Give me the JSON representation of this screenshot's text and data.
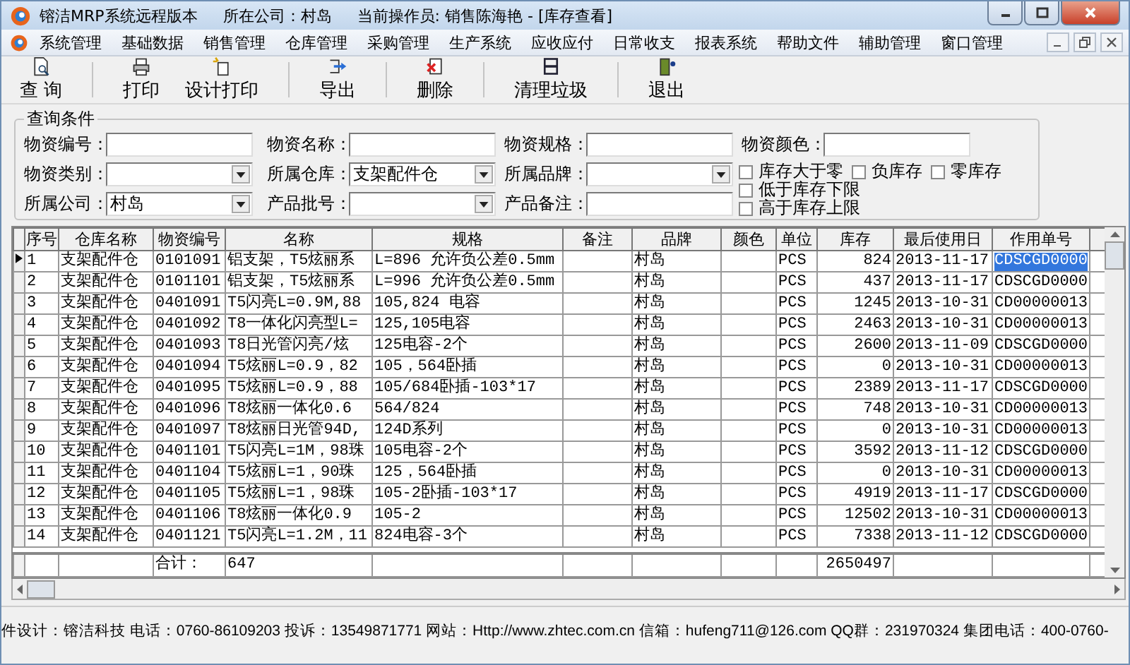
{
  "window": {
    "title": "镕洁MRP系统远程版本",
    "company": "所在公司：村岛",
    "operator": "当前操作员: 销售陈海艳 - [库存查看]"
  },
  "menu": [
    "系统管理",
    "基础数据",
    "销售管理",
    "仓库管理",
    "采购管理",
    "生产系统",
    "应收应付",
    "日常收支",
    "报表系统",
    "帮助文件",
    "辅助管理",
    "窗口管理"
  ],
  "toolbar": [
    {
      "label": "查 询"
    },
    {
      "label": "打印"
    },
    {
      "label": "设计打印"
    },
    {
      "label": "导出"
    },
    {
      "label": "删除"
    },
    {
      "label": "清理垃圾"
    },
    {
      "label": "退出"
    }
  ],
  "query": {
    "title": "查询条件",
    "fields": [
      {
        "label": "物资编号：",
        "kind": "text"
      },
      {
        "label": "物资名称：",
        "kind": "text"
      },
      {
        "label": "物资规格：",
        "kind": "text"
      },
      {
        "label": "物资颜色：",
        "kind": "text"
      },
      {
        "label": "物资类别：",
        "kind": "select"
      },
      {
        "label": "所属仓库：",
        "kind": "select",
        "value": "支架配件仓"
      },
      {
        "label": "所属品牌：",
        "kind": "select"
      },
      {
        "label": "所属公司：",
        "kind": "select",
        "value": "村岛"
      },
      {
        "label": "产品批号：",
        "kind": "select"
      },
      {
        "label": "产品备注：",
        "kind": "text"
      }
    ],
    "checkboxes": [
      {
        "label": "库存大于零",
        "checked": false
      },
      {
        "label": "负库存",
        "checked": false
      },
      {
        "label": "零库存",
        "checked": false
      },
      {
        "label": "低于库存下限",
        "checked": false
      },
      {
        "label": "高于库存上限",
        "checked": false
      }
    ]
  },
  "table": {
    "columns": [
      "序号",
      "仓库名称",
      "物资编号",
      "名称",
      "规格",
      "备注",
      "品牌",
      "颜色",
      "单位",
      "库存",
      "最后使用日",
      "作用单号"
    ],
    "rows": [
      {
        "selected": true,
        "seq": "1",
        "warehouse": "支架配件仓",
        "code": "0101091",
        "name": "铝支架，T5炫丽系",
        "spec": "L=896 允许负公差0.5mm",
        "brand": "村岛",
        "unit": "PCS",
        "stock": "824",
        "last_used": "2013-11-17",
        "doc_no": "CDSCGD0000"
      },
      {
        "selected": false,
        "seq": "2",
        "warehouse": "支架配件仓",
        "code": "0101101",
        "name": "铝支架，T5炫丽系",
        "spec": "L=996 允许负公差0.5mm",
        "brand": "村岛",
        "unit": "PCS",
        "stock": "437",
        "last_used": "2013-11-17",
        "doc_no": "CDSCGD0000"
      },
      {
        "selected": false,
        "seq": "3",
        "warehouse": "支架配件仓",
        "code": "0401091",
        "name": "T5闪亮L=0.9M,88",
        "spec": "105,824 电容",
        "brand": "村岛",
        "unit": "PCS",
        "stock": "1245",
        "last_used": "2013-10-31",
        "doc_no": "CD00000013"
      },
      {
        "selected": false,
        "seq": "4",
        "warehouse": "支架配件仓",
        "code": "0401092",
        "name": "T8一体化闪亮型L=",
        "spec": "125,105电容",
        "brand": "村岛",
        "unit": "PCS",
        "stock": "2463",
        "last_used": "2013-10-31",
        "doc_no": "CD00000013"
      },
      {
        "selected": false,
        "seq": "5",
        "warehouse": "支架配件仓",
        "code": "0401093",
        "name": "T8日光管闪亮/炫",
        "spec": "125电容-2个",
        "brand": "村岛",
        "unit": "PCS",
        "stock": "2600",
        "last_used": "2013-11-09",
        "doc_no": "CDSCGD0000"
      },
      {
        "selected": false,
        "seq": "6",
        "warehouse": "支架配件仓",
        "code": "0401094",
        "name": "T5炫丽L=0.9，82",
        "spec": "105，564卧插",
        "brand": "村岛",
        "unit": "PCS",
        "stock": "0",
        "last_used": "2013-10-31",
        "doc_no": "CD00000013"
      },
      {
        "selected": false,
        "seq": "7",
        "warehouse": "支架配件仓",
        "code": "0401095",
        "name": "T5炫丽L=0.9，88",
        "spec": "105/684卧插-103*17",
        "brand": "村岛",
        "unit": "PCS",
        "stock": "2389",
        "last_used": "2013-11-17",
        "doc_no": "CDSCGD0000"
      },
      {
        "selected": false,
        "seq": "8",
        "warehouse": "支架配件仓",
        "code": "0401096",
        "name": "T8炫丽一体化0.6",
        "spec": "564/824",
        "brand": "村岛",
        "unit": "PCS",
        "stock": "748",
        "last_used": "2013-10-31",
        "doc_no": "CD00000013"
      },
      {
        "selected": false,
        "seq": "9",
        "warehouse": "支架配件仓",
        "code": "0401097",
        "name": "T8炫丽日光管94D,",
        "spec": "124D系列",
        "brand": "村岛",
        "unit": "PCS",
        "stock": "0",
        "last_used": "2013-10-31",
        "doc_no": "CD00000013"
      },
      {
        "selected": false,
        "seq": "10",
        "warehouse": "支架配件仓",
        "code": "0401101",
        "name": "T5闪亮L=1M，98珠",
        "spec": "105电容-2个",
        "brand": "村岛",
        "unit": "PCS",
        "stock": "3592",
        "last_used": "2013-11-12",
        "doc_no": "CDSCGD0000"
      },
      {
        "selected": false,
        "seq": "11",
        "warehouse": "支架配件仓",
        "code": "0401104",
        "name": "T5炫丽L=1，90珠",
        "spec": "125，564卧插",
        "brand": "村岛",
        "unit": "PCS",
        "stock": "0",
        "last_used": "2013-10-31",
        "doc_no": "CD00000013"
      },
      {
        "selected": false,
        "seq": "12",
        "warehouse": "支架配件仓",
        "code": "0401105",
        "name": "T5炫丽L=1，98珠",
        "spec": "105-2卧插-103*17",
        "brand": "村岛",
        "unit": "PCS",
        "stock": "4919",
        "last_used": "2013-11-17",
        "doc_no": "CDSCGD0000"
      },
      {
        "selected": false,
        "seq": "13",
        "warehouse": "支架配件仓",
        "code": "0401106",
        "name": "T8炫丽一体化0.9",
        "spec": "105-2",
        "brand": "村岛",
        "unit": "PCS",
        "stock": "12502",
        "last_used": "2013-10-31",
        "doc_no": "CD00000013"
      },
      {
        "selected": false,
        "seq": "14",
        "warehouse": "支架配件仓",
        "code": "0401121",
        "name": "T5闪亮L=1.2M，11",
        "spec": "824电容-3个",
        "brand": "村岛",
        "unit": "PCS",
        "stock": "7338",
        "last_used": "2013-11-12",
        "doc_no": "CDSCGD0000"
      }
    ],
    "totals": {
      "label": "合计：",
      "name": "647",
      "stock": "2650497"
    }
  },
  "status_bar": "件设计：镕洁科技 电话：0760-86109203  投诉：13549871771 网站：Http://www.zhtec.com.cn 信箱：hufeng711@126.com QQ群：231970324 集团电话：400-0760-"
}
